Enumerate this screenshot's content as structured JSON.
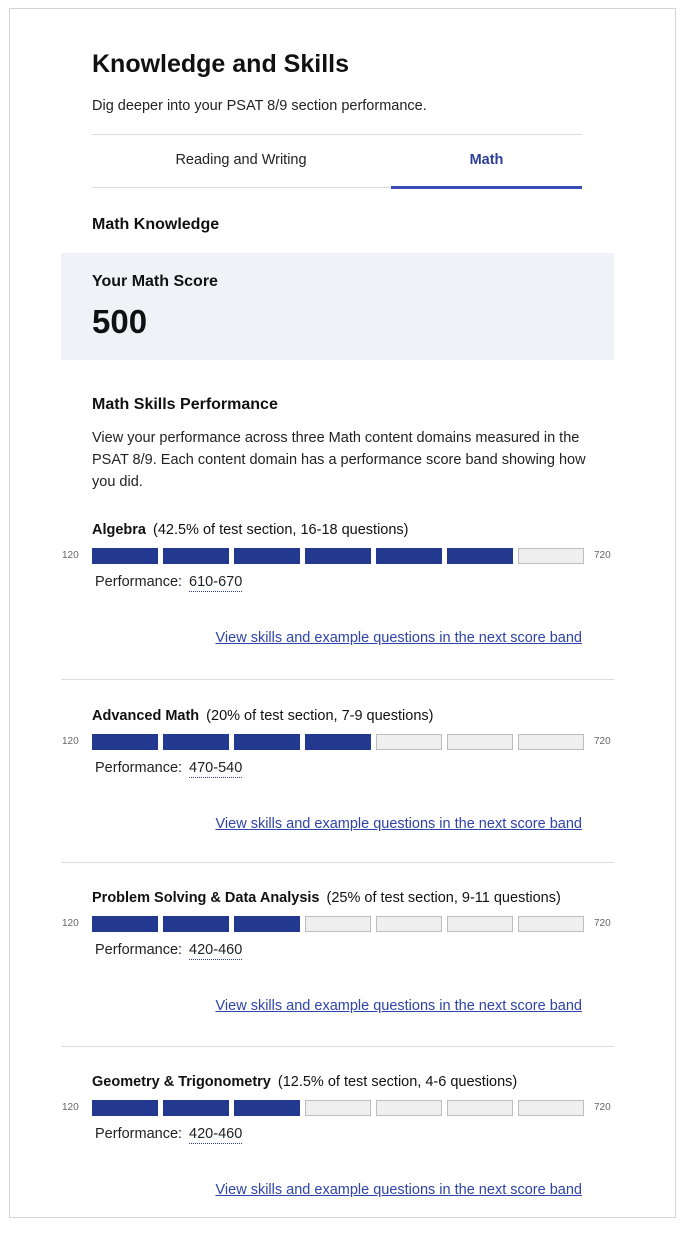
{
  "header": {
    "title": "Knowledge and Skills",
    "subtitle": "Dig deeper into your PSAT 8/9 section performance."
  },
  "tabs": [
    {
      "label": "Reading and Writing",
      "active": false
    },
    {
      "label": "Math",
      "active": true
    }
  ],
  "section_heading": "Math Knowledge",
  "score_card": {
    "label": "Your Math Score",
    "value": "500"
  },
  "performance": {
    "heading": "Math Skills Performance",
    "description": "View your performance across three Math content domains measured in the PSAT 8/9. Each content domain has a performance score band showing how you did."
  },
  "scale": {
    "min": "120",
    "max": "720"
  },
  "performance_label": "Performance:",
  "link_text": "View skills and example questions in the next score band",
  "colors": {
    "filled": "#233990",
    "accent": "#3a4cb4",
    "link": "#2f43a8"
  },
  "domains": [
    {
      "name": "Algebra",
      "meta": "(42.5% of test section, 16-18 questions)",
      "range": "610-670",
      "filled_segments": 6,
      "total_segments": 7
    },
    {
      "name": "Advanced Math",
      "meta": "(20% of test section, 7-9 questions)",
      "range": "470-540",
      "filled_segments": 4,
      "total_segments": 7
    },
    {
      "name": "Problem Solving & Data Analysis",
      "meta": "(25% of test section, 9-11 questions)",
      "range": "420-460",
      "filled_segments": 3,
      "total_segments": 7
    },
    {
      "name": "Geometry & Trigonometry",
      "meta": "(12.5% of test section, 4-6 questions)",
      "range": "420-460",
      "filled_segments": 3,
      "total_segments": 7
    }
  ]
}
